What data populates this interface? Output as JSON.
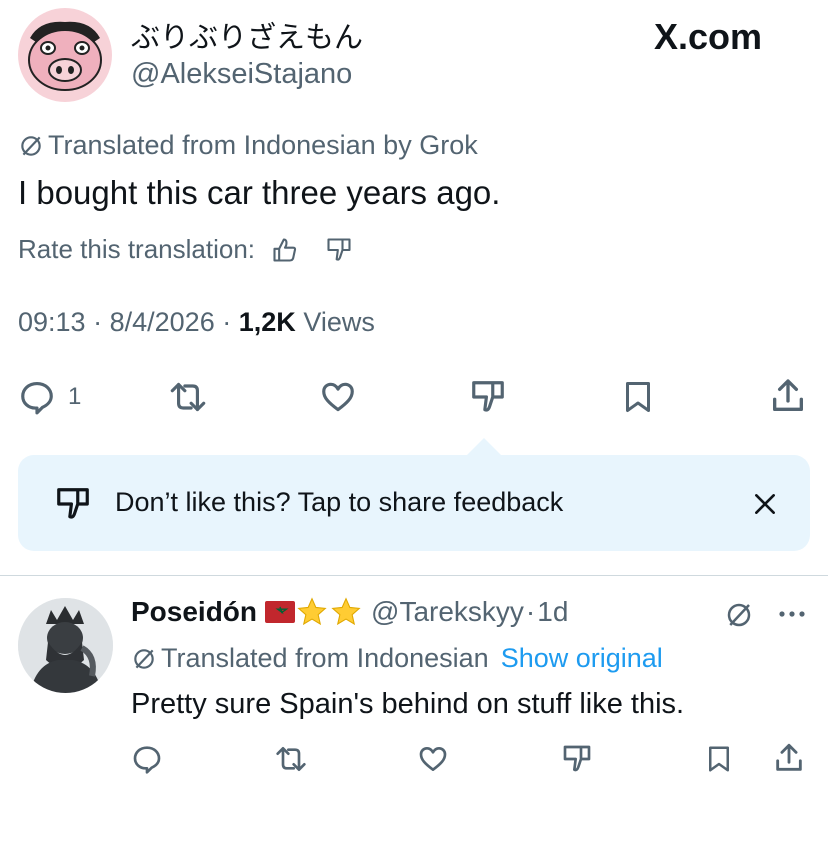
{
  "header": {
    "display_name": "ぶりぶりざえもん",
    "handle": "@AlekseiStajano",
    "watermark": "X.com"
  },
  "tweet": {
    "translation_note": "Translated from Indonesian by Grok",
    "text": "I bought this car three years ago.",
    "rate_label": "Rate this translation:",
    "time": "09:13",
    "date": "8/4/2026",
    "views_count": "1,2K",
    "views_label": "Views",
    "separator": "·",
    "reply_count": "1"
  },
  "feedback_banner": {
    "text": "Don’t like this? Tap to share feedback"
  },
  "reply": {
    "name": "Poseidón",
    "badges": [
      "flag-morocco-icon",
      "star-icon",
      "star-icon"
    ],
    "handle": "@Tarekskyy",
    "time": "1d",
    "separator": "·",
    "translation_note": "Translated from Indonesian",
    "show_original": "Show original",
    "text": "Pretty sure Spain's behind on stuff like this."
  },
  "colors": {
    "muted": "#536471",
    "link": "#1d9bf0",
    "banner_bg": "#e8f5fd",
    "divider": "#cfd9de",
    "avatar1_bg": "#f4c6cf"
  }
}
